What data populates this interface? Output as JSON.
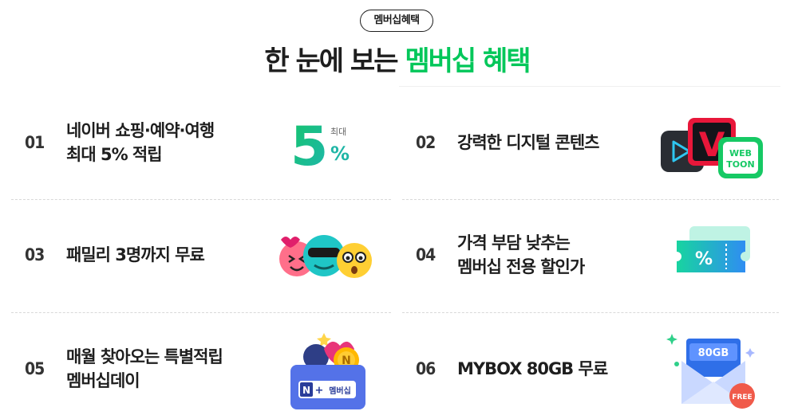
{
  "header": {
    "badge": "멤버십혜택",
    "title_plain": "한 눈에 보는 ",
    "title_accent": "멤버십 혜택"
  },
  "colors": {
    "accent": "#03c75a",
    "text": "#1e1e1e"
  },
  "benefits": [
    {
      "num": "01",
      "line1": "네이버 쇼핑·예약·여행",
      "line2": "최대 5% 적립",
      "icon": "five-percent-icon",
      "icon_text": {
        "small": "최대",
        "big": "5",
        "pct": "%"
      }
    },
    {
      "num": "02",
      "line1": "강력한 디지털 콘텐츠",
      "line2": "",
      "icon": "digital-content-apps-icon",
      "icon_text": {
        "webtoon": "WEB\nTOON"
      }
    },
    {
      "num": "03",
      "line1": "패밀리 3명까지 무료",
      "line2": "",
      "icon": "emoji-faces-icon"
    },
    {
      "num": "04",
      "line1": "가격 부담 낮추는",
      "line2": "멤버십 전용 할인가",
      "icon": "discount-coupon-icon",
      "icon_text": {
        "pct": "%"
      }
    },
    {
      "num": "05",
      "line1": "매월 찾아오는 특별적립",
      "line2": "멤버십데이",
      "icon": "membership-gift-box-icon",
      "icon_text": {
        "box_label": "멤버십",
        "n": "N",
        "plus": "+"
      }
    },
    {
      "num": "06",
      "line1": "MYBOX 80GB 무료",
      "line2": "",
      "icon": "mybox-envelope-icon",
      "icon_text": {
        "card": "80GB",
        "tag": "FREE"
      }
    }
  ]
}
